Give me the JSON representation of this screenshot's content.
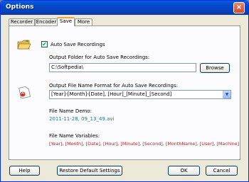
{
  "window": {
    "title": "Options",
    "close_glyph": "×"
  },
  "tabs": [
    {
      "label": "Recorder",
      "active": false
    },
    {
      "label": "Encoder",
      "active": false
    },
    {
      "label": "Save",
      "active": true
    },
    {
      "label": "More",
      "active": false
    }
  ],
  "auto_save": {
    "label": "Auto Save Recordings",
    "checked": true,
    "check_glyph": "✔"
  },
  "output_folder": {
    "label": "Output Folder for Auto Save Recordings:",
    "value": "C:\\Softpedia\\",
    "browse_label": "Browse"
  },
  "file_name_format": {
    "label": "Output File Name Format for Auto Save Recordings:",
    "value": "[Year]-[Month]-[Date], [Hour]_[Minute]_[Second]",
    "dropdown_glyph": "▼"
  },
  "file_name_demo": {
    "label": "File Name Demo:",
    "value": "2011-11-28, 09_13_49.avi"
  },
  "file_name_variables": {
    "label": "File Name Variables:",
    "value": "[Year], [Month], [Date], [Hour], [Minute], [Second], [MonthName], [User], [Machine]"
  },
  "buttons": {
    "help": "Help",
    "restore": "Restore Default Settings",
    "ok": "OK",
    "cancel": "Cancel"
  },
  "colors": {
    "titlebar": "#0546c8",
    "demo_text": "#1f7a8a",
    "variables_text": "#b02020",
    "tab_highlight": "#f9a330"
  },
  "icons": [
    "folder-icon",
    "document-pdf-icon"
  ]
}
